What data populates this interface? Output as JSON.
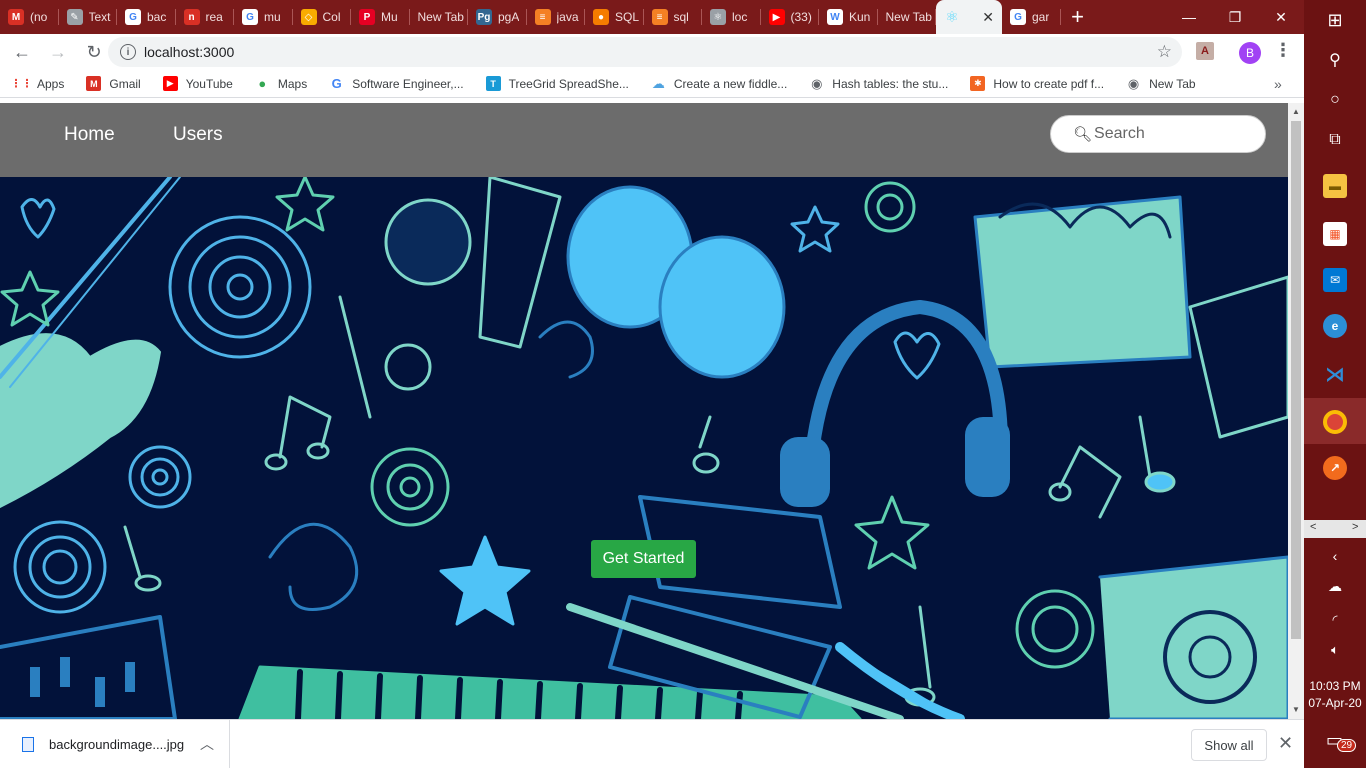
{
  "browser": {
    "tabs": [
      {
        "title": "(no",
        "icon": "gmail-icon",
        "color": "#d93025",
        "glyph": "M"
      },
      {
        "title": "Text",
        "icon": "editor-icon",
        "color": "#9aa0a6",
        "glyph": "✎"
      },
      {
        "title": "bac",
        "icon": "google-icon",
        "color": "#ffffff",
        "glyph": "G"
      },
      {
        "title": "rea",
        "icon": "red-doc-icon",
        "color": "#d93025",
        "glyph": "n"
      },
      {
        "title": "mu",
        "icon": "google-icon",
        "color": "#ffffff",
        "glyph": "G"
      },
      {
        "title": "Col",
        "icon": "diamond-icon",
        "color": "#f9ab00",
        "glyph": "◇"
      },
      {
        "title": "Mu",
        "icon": "pinterest-icon",
        "color": "#e60023",
        "glyph": "P"
      },
      {
        "title": "New Tab",
        "icon": "",
        "color": "",
        "glyph": ""
      },
      {
        "title": "pgA",
        "icon": "pgadmin-icon",
        "color": "#336791",
        "glyph": "Pg"
      },
      {
        "title": "java",
        "icon": "stackoverflow-icon",
        "color": "#f48024",
        "glyph": "≡"
      },
      {
        "title": "SQL",
        "icon": "orange-circle-icon",
        "color": "#f57c00",
        "glyph": "●"
      },
      {
        "title": "sql",
        "icon": "stackoverflow-icon",
        "color": "#f48024",
        "glyph": "≡"
      },
      {
        "title": "loc",
        "icon": "react-icon",
        "color": "#9aa0a6",
        "glyph": "⚛"
      },
      {
        "title": "(33)",
        "icon": "youtube-icon",
        "color": "#ff0000",
        "glyph": "▶"
      },
      {
        "title": "Kun",
        "icon": "wikipedia-icon",
        "color": "#ffffff",
        "glyph": "W"
      },
      {
        "title": "New Tab",
        "icon": "",
        "color": "",
        "glyph": ""
      },
      {
        "title": "",
        "icon": "react-icon",
        "color": "#61dafb",
        "glyph": "⚛",
        "active": true
      },
      {
        "title": "gar",
        "icon": "google-icon",
        "color": "#ffffff",
        "glyph": "G"
      }
    ],
    "url": "localhost:3000",
    "avatar_letter": "B",
    "bookmarks": [
      {
        "label": "Apps",
        "icon": "apps-icon",
        "color": "#ea4335",
        "glyph": "⋮⋮"
      },
      {
        "label": "Gmail",
        "icon": "gmail-icon",
        "color": "#d93025",
        "glyph": "M"
      },
      {
        "label": "YouTube",
        "icon": "youtube-icon",
        "color": "#ff0000",
        "glyph": "▶"
      },
      {
        "label": "Maps",
        "icon": "maps-icon",
        "color": "#34a853",
        "glyph": "●"
      },
      {
        "label": "Software Engineer,...",
        "icon": "google-icon",
        "color": "#4285f4",
        "glyph": "G"
      },
      {
        "label": "TreeGrid SpreadShe...",
        "icon": "treegrid-icon",
        "color": "#1a9ad6",
        "glyph": "T"
      },
      {
        "label": "Create a new fiddle...",
        "icon": "cloud-icon",
        "color": "#4fa3e0",
        "glyph": "☁"
      },
      {
        "label": "Hash tables: the stu...",
        "icon": "globe-icon",
        "color": "#5f6368",
        "glyph": "◉"
      },
      {
        "label": "How to create pdf f...",
        "icon": "pdf-icon",
        "color": "#f26522",
        "glyph": "✱"
      },
      {
        "label": "New Tab",
        "icon": "globe-icon",
        "color": "#5f6368",
        "glyph": "◉"
      }
    ]
  },
  "page": {
    "nav": {
      "home": "Home",
      "users": "Users"
    },
    "search": {
      "placeholder": "Search"
    },
    "cta": "Get Started"
  },
  "downloads": {
    "file": "backgroundimage....jpg",
    "show_all": "Show all"
  },
  "taskbar": {
    "time": "10:03 PM",
    "date": "07-Apr-20",
    "notifications": "29"
  },
  "colors": {
    "tabstrip": "#7a1a1a",
    "navbar": "#6c6c6c",
    "hero_bg": "#02123a",
    "cta": "#28a745",
    "taskbar": "#6b1212"
  }
}
